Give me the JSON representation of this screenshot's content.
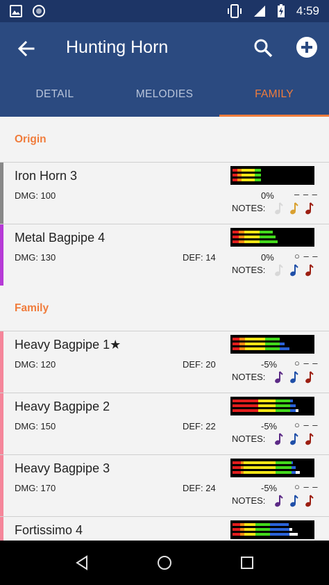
{
  "status": {
    "time": "4:59"
  },
  "app_bar": {
    "title": "Hunting Horn"
  },
  "tabs": [
    {
      "label": "DETAIL",
      "active": false
    },
    {
      "label": "MELODIES",
      "active": false
    },
    {
      "label": "FAMILY",
      "active": true
    }
  ],
  "colors": {
    "accent": "#f07c3c",
    "app_bar": "#2b4a80",
    "status_bar": "#1d3566",
    "note_white": "#d8d8d8",
    "note_yellow": "#d9a030",
    "note_red": "#9c1f12",
    "note_purple": "#5c2a86",
    "note_blue": "#1f4fa8",
    "sharpness": [
      "#e21d1d",
      "#f28a14",
      "#f2e516",
      "#43d81c",
      "#2b63d8",
      "#ffffff"
    ]
  },
  "sections": [
    {
      "title": "Origin",
      "weapons": [
        {
          "name": "Iron Horn 3",
          "dmg": "DMG: 100",
          "def": "",
          "affinity": "0%",
          "slots": "– – –",
          "notes_label": "NOTES:",
          "notes": [
            "white-note-icon",
            "yellow-note-icon",
            "red-note-icon"
          ],
          "stripe": "#888888",
          "sharpness": [
            [
              7,
              6,
              19,
              9,
              0,
              0
            ],
            [
              7,
              6,
              19,
              9,
              0,
              0
            ],
            [
              7,
              6,
              19,
              9,
              0,
              0
            ]
          ]
        },
        {
          "name": "Metal Bagpipe 4",
          "dmg": "DMG: 130",
          "def": "DEF: 14",
          "affinity": "0%",
          "slots": "○ – –",
          "notes_label": "NOTES:",
          "notes": [
            "white-note-icon",
            "blue-note-icon",
            "red-note-icon"
          ],
          "stripe": "#b63ad6",
          "sharpness": [
            [
              9,
              8,
              22,
              19,
              0,
              0
            ],
            [
              9,
              8,
              22,
              23,
              0,
              0
            ],
            [
              9,
              8,
              22,
              26,
              0,
              0
            ]
          ]
        }
      ]
    },
    {
      "title": "Family",
      "weapons": [
        {
          "name": "Heavy Bagpipe 1★",
          "dmg": "DMG: 120",
          "def": "DEF: 20",
          "affinity": "-5%",
          "slots": "○ – –",
          "notes_label": "NOTES:",
          "notes": [
            "purple-note-icon",
            "blue-note-icon",
            "red-note-icon"
          ],
          "stripe": "#f5869a",
          "sharpness": [
            [
              10,
              8,
              29,
              21,
              0,
              0
            ],
            [
              10,
              8,
              29,
              21,
              7,
              0
            ],
            [
              10,
              8,
              29,
              21,
              14,
              0
            ]
          ]
        },
        {
          "name": "Heavy Bagpipe 2",
          "dmg": "DMG: 150",
          "def": "DEF: 22",
          "affinity": "-5%",
          "slots": "○ – –",
          "notes_label": "NOTES:",
          "notes": [
            "purple-note-icon",
            "blue-note-icon",
            "red-note-icon"
          ],
          "stripe": "#f5869a",
          "sharpness": [
            [
              37,
              0,
              25,
              21,
              4,
              0
            ],
            [
              37,
              0,
              25,
              21,
              8,
              0
            ],
            [
              37,
              0,
              25,
              21,
              8,
              4
            ]
          ]
        },
        {
          "name": "Heavy Bagpipe 3",
          "dmg": "DMG: 170",
          "def": "DEF: 24",
          "affinity": "-5%",
          "slots": "○ – –",
          "notes_label": "NOTES:",
          "notes": [
            "purple-note-icon",
            "blue-note-icon",
            "red-note-icon"
          ],
          "stripe": "#f5869a",
          "sharpness": [
            [
              12,
              4,
              46,
              23,
              2,
              0
            ],
            [
              12,
              4,
              46,
              23,
              6,
              0
            ],
            [
              12,
              4,
              46,
              23,
              6,
              6
            ]
          ]
        },
        {
          "name": "Fortissimo 4",
          "dmg": "",
          "def": "",
          "affinity": "",
          "slots": "",
          "notes_label": "",
          "notes": [],
          "stripe": "#f5869a",
          "sharpness": [
            [
              11,
              6,
              16,
              21,
              27,
              0
            ],
            [
              11,
              6,
              16,
              21,
              28,
              4
            ],
            [
              11,
              6,
              16,
              21,
              28,
              12
            ]
          ]
        }
      ]
    }
  ]
}
